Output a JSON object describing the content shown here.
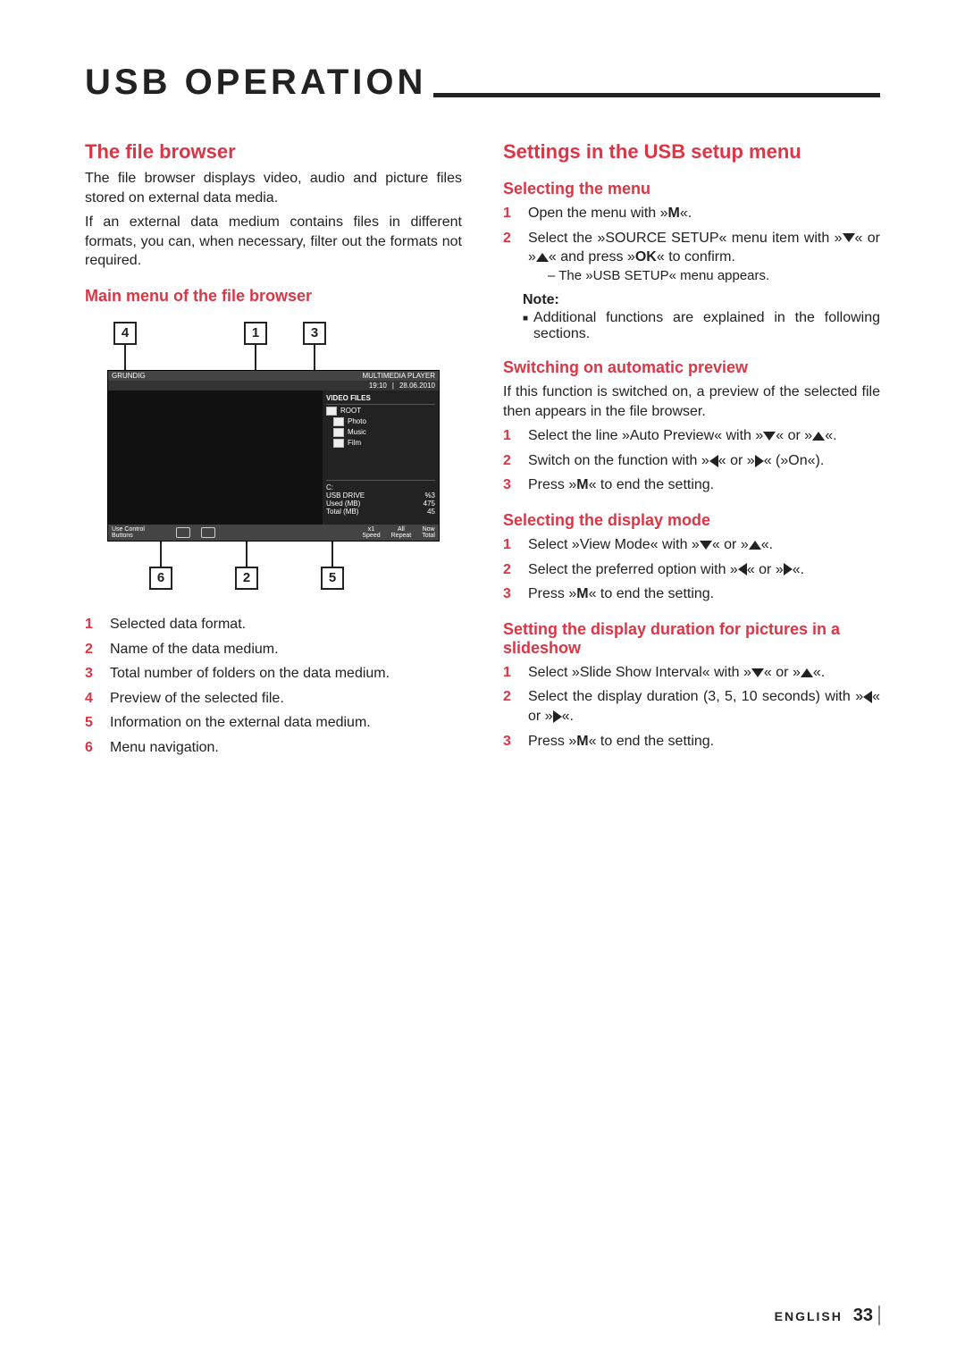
{
  "page_title": "USB OPERATION",
  "left": {
    "h_file_browser": "The file browser",
    "p1": "The file browser displays video, audio and picture files stored on external data media.",
    "p2": "If an external data medium contains files in different formats, you can, when necessary, filter out the formats not required.",
    "h_mainmenu": "Main menu of the file browser",
    "callouts_top": [
      "4",
      "1",
      "3"
    ],
    "callouts_bottom": [
      "6",
      "2",
      "5"
    ],
    "screenshot": {
      "brand": "GRUNDIG",
      "mode": "MULTIMEDIA PLAYER",
      "time": "19:10",
      "date": "28.06.2010",
      "header": "VIDEO FILES",
      "tree": [
        "ROOT",
        "Photo",
        "Music",
        "Film"
      ],
      "drive_label": "C:",
      "drive_name": "USB DRIVE",
      "drive_pct": "%3",
      "used_label": "Used (MB)",
      "used_val": "475",
      "total_label": "Total (MB)",
      "total_val": "45",
      "btns_label": "Use Control Buttons",
      "speed_label": "Speed",
      "speed_val": "x1",
      "repeat_label": "Repeat",
      "repeat_val": "All",
      "total_play_label": "Total",
      "total_play_val": "Now"
    },
    "legend": [
      {
        "n": "1",
        "t": "Selected data format."
      },
      {
        "n": "2",
        "t": "Name of the data medium."
      },
      {
        "n": "3",
        "t": "Total number of folders on the data medium."
      },
      {
        "n": "4",
        "t": "Preview of the selected file."
      },
      {
        "n": "5",
        "t": "Information on the external data medium."
      },
      {
        "n": "6",
        "t": "Menu navigation."
      }
    ]
  },
  "right": {
    "h_settings": "Settings in the USB setup menu",
    "h_selecting": "Selecting the menu",
    "sel_steps": [
      {
        "n": "1",
        "pre": "Open the menu with »",
        "key": "M",
        "post": "«."
      },
      {
        "n": "2",
        "pre": "  Select the »SOURCE SETUP« menu item with »",
        "post": "« or »",
        "post2": "« and press »",
        "ok": "OK",
        "post3": "« to confirm."
      }
    ],
    "sel_sub": "– The »USB SETUP« menu appears.",
    "note_label": "Note:",
    "note_body": "Additional functions are explained in the following sections.",
    "h_autoprev": "Switching on automatic preview",
    "autoprev_intro": "If this function is switched on, a preview of the selected file then appears in the file browser.",
    "autoprev_steps": [
      {
        "n": "1",
        "pre": "Select the line »Auto Preview« with »",
        "mid": "« or »",
        "post": "«."
      },
      {
        "n": "2",
        "pre": "Switch on the function with »",
        "mid": "« or »",
        "post": "« (»On«)."
      },
      {
        "n": "3",
        "pre": "Press »",
        "key": "M",
        "post": "« to end the setting."
      }
    ],
    "h_display": "Selecting the display mode",
    "display_steps": [
      {
        "n": "1",
        "pre": "Select »View Mode« with »",
        "mid": "« or »",
        "post": "«."
      },
      {
        "n": "2",
        "pre": "Select the preferred option with »",
        "mid": "« or »",
        "post": "«."
      },
      {
        "n": "3",
        "pre": "Press »",
        "key": "M",
        "post": "« to end the setting."
      }
    ],
    "h_slide": "Setting the display duration for pictures in a slideshow",
    "slide_steps": [
      {
        "n": "1",
        "pre": "Select »Slide Show Interval« with »",
        "mid": "« or »",
        "post": "«."
      },
      {
        "n": "2",
        "pre": "Select the display duration (3, 5, 10 seconds) with »",
        "mid": "« or »",
        "post": "«."
      },
      {
        "n": "3",
        "pre": "Press »",
        "key": "M",
        "post": "« to end the setting."
      }
    ]
  },
  "footer": {
    "lang": "ENGLISH",
    "page": "33"
  }
}
